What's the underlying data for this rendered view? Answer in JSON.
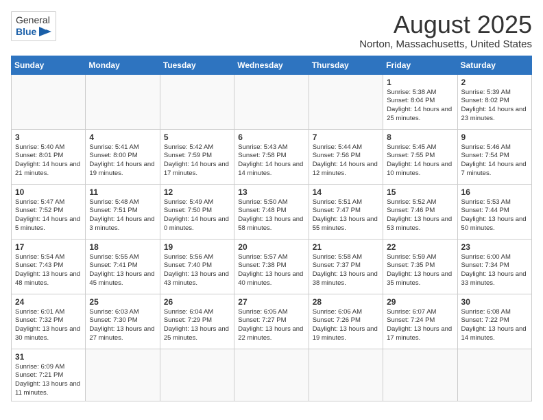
{
  "header": {
    "logo_general": "General",
    "logo_blue": "Blue",
    "title": "August 2025",
    "subtitle": "Norton, Massachusetts, United States"
  },
  "days_of_week": [
    "Sunday",
    "Monday",
    "Tuesday",
    "Wednesday",
    "Thursday",
    "Friday",
    "Saturday"
  ],
  "weeks": [
    [
      {
        "day": "",
        "info": ""
      },
      {
        "day": "",
        "info": ""
      },
      {
        "day": "",
        "info": ""
      },
      {
        "day": "",
        "info": ""
      },
      {
        "day": "",
        "info": ""
      },
      {
        "day": "1",
        "info": "Sunrise: 5:38 AM\nSunset: 8:04 PM\nDaylight: 14 hours and 25 minutes."
      },
      {
        "day": "2",
        "info": "Sunrise: 5:39 AM\nSunset: 8:02 PM\nDaylight: 14 hours and 23 minutes."
      }
    ],
    [
      {
        "day": "3",
        "info": "Sunrise: 5:40 AM\nSunset: 8:01 PM\nDaylight: 14 hours and 21 minutes."
      },
      {
        "day": "4",
        "info": "Sunrise: 5:41 AM\nSunset: 8:00 PM\nDaylight: 14 hours and 19 minutes."
      },
      {
        "day": "5",
        "info": "Sunrise: 5:42 AM\nSunset: 7:59 PM\nDaylight: 14 hours and 17 minutes."
      },
      {
        "day": "6",
        "info": "Sunrise: 5:43 AM\nSunset: 7:58 PM\nDaylight: 14 hours and 14 minutes."
      },
      {
        "day": "7",
        "info": "Sunrise: 5:44 AM\nSunset: 7:56 PM\nDaylight: 14 hours and 12 minutes."
      },
      {
        "day": "8",
        "info": "Sunrise: 5:45 AM\nSunset: 7:55 PM\nDaylight: 14 hours and 10 minutes."
      },
      {
        "day": "9",
        "info": "Sunrise: 5:46 AM\nSunset: 7:54 PM\nDaylight: 14 hours and 7 minutes."
      }
    ],
    [
      {
        "day": "10",
        "info": "Sunrise: 5:47 AM\nSunset: 7:52 PM\nDaylight: 14 hours and 5 minutes."
      },
      {
        "day": "11",
        "info": "Sunrise: 5:48 AM\nSunset: 7:51 PM\nDaylight: 14 hours and 3 minutes."
      },
      {
        "day": "12",
        "info": "Sunrise: 5:49 AM\nSunset: 7:50 PM\nDaylight: 14 hours and 0 minutes."
      },
      {
        "day": "13",
        "info": "Sunrise: 5:50 AM\nSunset: 7:48 PM\nDaylight: 13 hours and 58 minutes."
      },
      {
        "day": "14",
        "info": "Sunrise: 5:51 AM\nSunset: 7:47 PM\nDaylight: 13 hours and 55 minutes."
      },
      {
        "day": "15",
        "info": "Sunrise: 5:52 AM\nSunset: 7:46 PM\nDaylight: 13 hours and 53 minutes."
      },
      {
        "day": "16",
        "info": "Sunrise: 5:53 AM\nSunset: 7:44 PM\nDaylight: 13 hours and 50 minutes."
      }
    ],
    [
      {
        "day": "17",
        "info": "Sunrise: 5:54 AM\nSunset: 7:43 PM\nDaylight: 13 hours and 48 minutes."
      },
      {
        "day": "18",
        "info": "Sunrise: 5:55 AM\nSunset: 7:41 PM\nDaylight: 13 hours and 45 minutes."
      },
      {
        "day": "19",
        "info": "Sunrise: 5:56 AM\nSunset: 7:40 PM\nDaylight: 13 hours and 43 minutes."
      },
      {
        "day": "20",
        "info": "Sunrise: 5:57 AM\nSunset: 7:38 PM\nDaylight: 13 hours and 40 minutes."
      },
      {
        "day": "21",
        "info": "Sunrise: 5:58 AM\nSunset: 7:37 PM\nDaylight: 13 hours and 38 minutes."
      },
      {
        "day": "22",
        "info": "Sunrise: 5:59 AM\nSunset: 7:35 PM\nDaylight: 13 hours and 35 minutes."
      },
      {
        "day": "23",
        "info": "Sunrise: 6:00 AM\nSunset: 7:34 PM\nDaylight: 13 hours and 33 minutes."
      }
    ],
    [
      {
        "day": "24",
        "info": "Sunrise: 6:01 AM\nSunset: 7:32 PM\nDaylight: 13 hours and 30 minutes."
      },
      {
        "day": "25",
        "info": "Sunrise: 6:03 AM\nSunset: 7:30 PM\nDaylight: 13 hours and 27 minutes."
      },
      {
        "day": "26",
        "info": "Sunrise: 6:04 AM\nSunset: 7:29 PM\nDaylight: 13 hours and 25 minutes."
      },
      {
        "day": "27",
        "info": "Sunrise: 6:05 AM\nSunset: 7:27 PM\nDaylight: 13 hours and 22 minutes."
      },
      {
        "day": "28",
        "info": "Sunrise: 6:06 AM\nSunset: 7:26 PM\nDaylight: 13 hours and 19 minutes."
      },
      {
        "day": "29",
        "info": "Sunrise: 6:07 AM\nSunset: 7:24 PM\nDaylight: 13 hours and 17 minutes."
      },
      {
        "day": "30",
        "info": "Sunrise: 6:08 AM\nSunset: 7:22 PM\nDaylight: 13 hours and 14 minutes."
      }
    ],
    [
      {
        "day": "31",
        "info": "Sunrise: 6:09 AM\nSunset: 7:21 PM\nDaylight: 13 hours and 11 minutes."
      },
      {
        "day": "",
        "info": ""
      },
      {
        "day": "",
        "info": ""
      },
      {
        "day": "",
        "info": ""
      },
      {
        "day": "",
        "info": ""
      },
      {
        "day": "",
        "info": ""
      },
      {
        "day": "",
        "info": ""
      }
    ]
  ]
}
